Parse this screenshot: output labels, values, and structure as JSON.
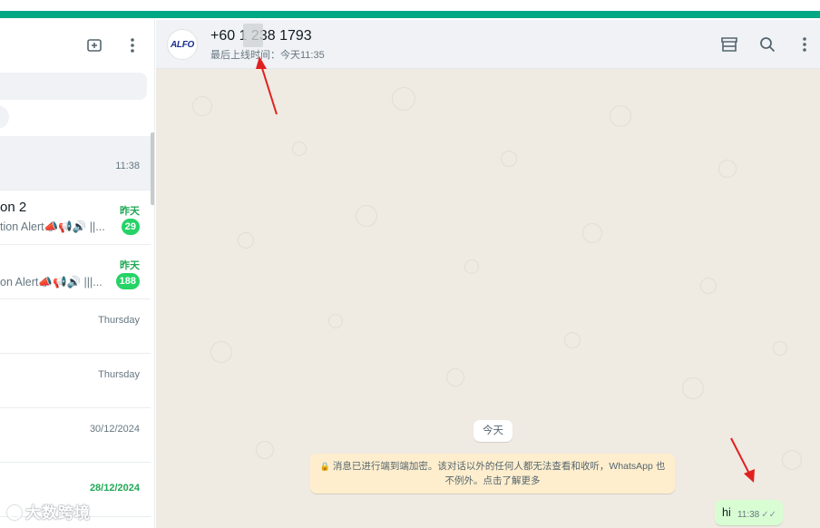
{
  "colors": {
    "brand_green": "#00a884",
    "unread_green": "#25d366",
    "chat_bg": "#efeae2",
    "outgoing_bubble": "#d9fdd3",
    "system_notice": "#ffeecd"
  },
  "sidebar": {
    "header_icons": [
      "new-chat-icon",
      "menu-dots-icon"
    ],
    "chats": [
      {
        "name": "",
        "preview": "",
        "time": "11:38",
        "unread": ""
      },
      {
        "name": "on 2",
        "preview": "tion Alert📣📢🔊 ||...",
        "time": "昨天",
        "unread": "29"
      },
      {
        "name": "",
        "preview": "on Alert📣📢🔊 |||...",
        "time": "昨天",
        "unread": "188"
      },
      {
        "name": "",
        "preview": "",
        "time": "Thursday",
        "unread": ""
      },
      {
        "name": "",
        "preview": "",
        "time": "Thursday",
        "unread": ""
      },
      {
        "name": "",
        "preview": "",
        "time": "30/12/2024",
        "unread": ""
      },
      {
        "name": "",
        "preview": "",
        "time": "28/12/2024",
        "unread": ""
      }
    ]
  },
  "chat": {
    "avatar_text": "ALFO",
    "contact_name": "+60 1 238 1793",
    "status": "最后上线时间：今天11:35",
    "header_icons": [
      "catalog-icon",
      "search-icon",
      "menu-dots-icon"
    ],
    "date_chip": "今天",
    "encryption_line1": "消息已进行端到端加密。该对话以外的任何人都无法查看和收听，WhatsApp 也",
    "encryption_line2": "不例外。点击了解更多",
    "messages": [
      {
        "text": "hi",
        "time": "11:38",
        "status": "read-ticks"
      }
    ]
  },
  "watermark": {
    "text": "大数跨境"
  }
}
